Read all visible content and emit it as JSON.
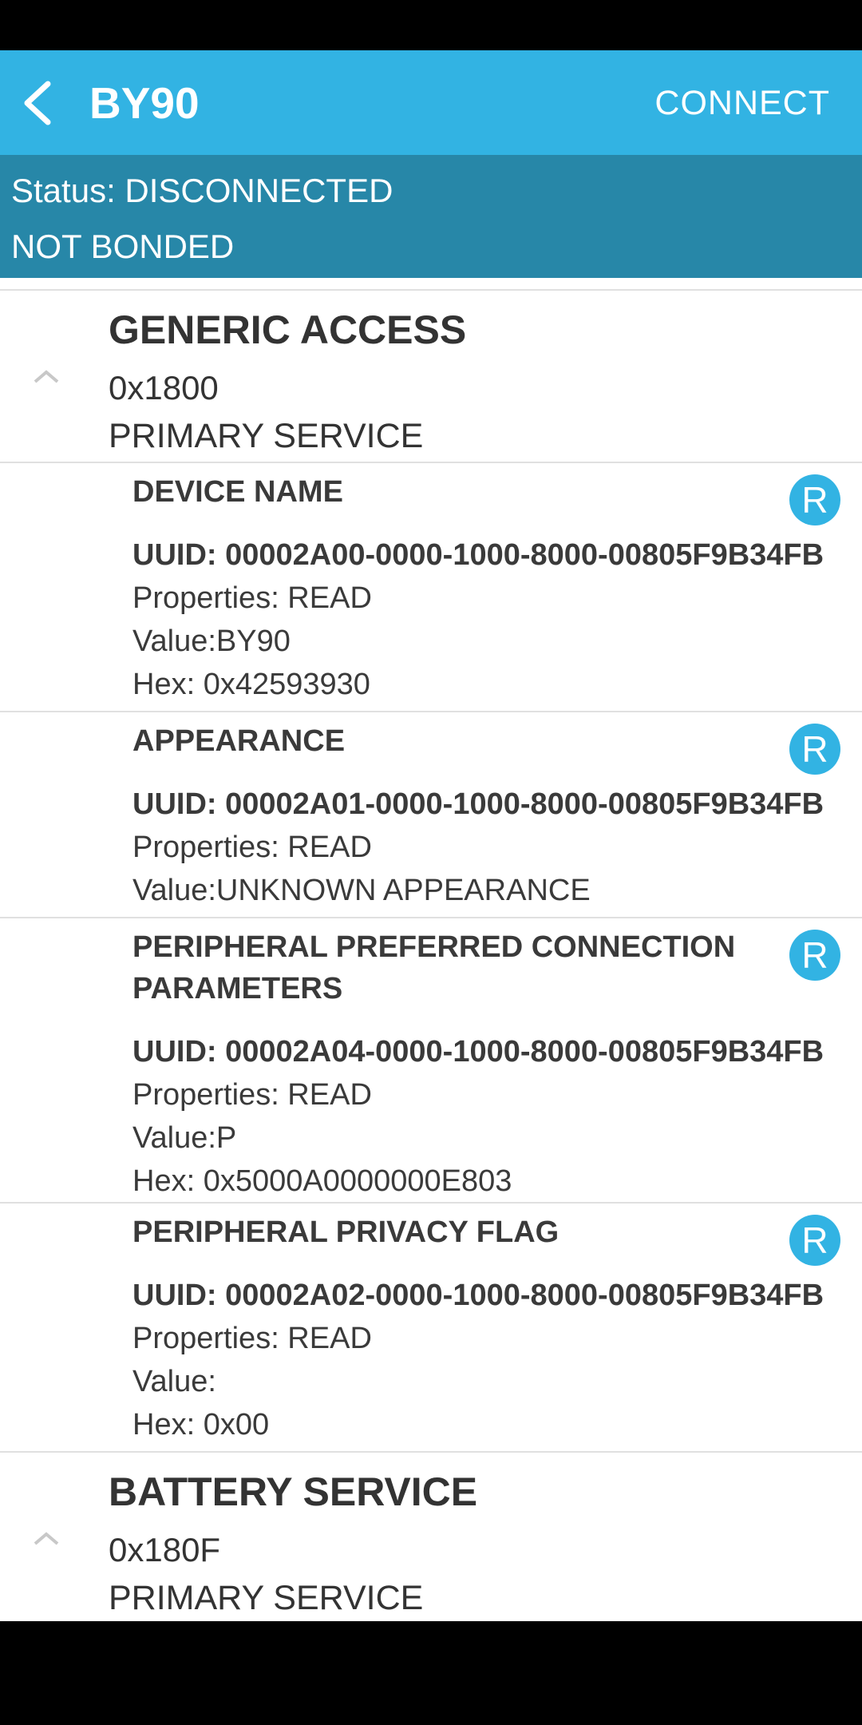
{
  "app": {
    "title": "BY90",
    "connect_label": "CONNECT"
  },
  "status": {
    "line1": "Status: DISCONNECTED",
    "line2": "NOT BONDED"
  },
  "services": [
    {
      "name": "GENERIC ACCESS",
      "uuid": "0x1800",
      "type": "PRIMARY SERVICE",
      "characteristics": [
        {
          "name": "DEVICE NAME",
          "uuid": "UUID: 00002A00-0000-1000-8000-00805F9B34FB",
          "properties": "Properties: READ",
          "value": "Value:BY90",
          "hex": "Hex: 0x42593930",
          "badge": "R"
        },
        {
          "name": "APPEARANCE",
          "uuid": "UUID: 00002A01-0000-1000-8000-00805F9B34FB",
          "properties": "Properties: READ",
          "value": "Value:UNKNOWN APPEARANCE",
          "badge": "R"
        },
        {
          "name": "PERIPHERAL PREFERRED CONNECTION PARAMETERS",
          "uuid": "UUID: 00002A04-0000-1000-8000-00805F9B34FB",
          "properties": "Properties: READ",
          "value": "Value:P",
          "hex": "Hex: 0x5000A0000000E803",
          "badge": "R"
        },
        {
          "name": "PERIPHERAL PRIVACY FLAG",
          "uuid": "UUID: 00002A02-0000-1000-8000-00805F9B34FB",
          "properties": "Properties: READ",
          "value": "Value:",
          "hex": "Hex: 0x00",
          "badge": "R"
        }
      ]
    },
    {
      "name": "BATTERY SERVICE",
      "uuid": "0x180F",
      "type": "PRIMARY SERVICE"
    }
  ],
  "colors": {
    "appbar": "#32b3e3",
    "status_panel": "#2787a8",
    "badge": "#32b3e3"
  }
}
